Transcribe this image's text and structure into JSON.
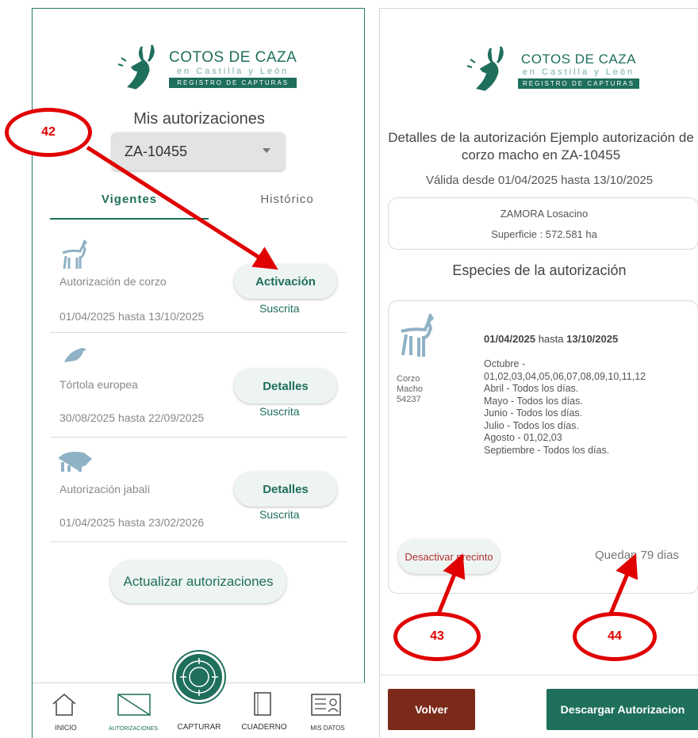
{
  "left": {
    "logo": {
      "title": "COTOS DE CAZA",
      "subtitle": "en Castilla y León",
      "tagline": "REGISTRO DE CAPTURAS"
    },
    "heading": "Mis autorizaciones",
    "coto_select": {
      "value": "ZA-10455"
    },
    "tabs": [
      {
        "label": "Vigentes",
        "active": true
      },
      {
        "label": "Histórico",
        "active": false
      }
    ],
    "items": [
      {
        "name": "Autorización de corzo",
        "dates": "01/04/2025 hasta 13/10/2025",
        "button": "Activación",
        "status": "Suscrita",
        "icon": "deer-icon"
      },
      {
        "name": "Tórtola europea",
        "dates": "30/08/2025 hasta 22/09/2025",
        "button": "Detalles",
        "status": "Suscrita",
        "icon": "bird-icon"
      },
      {
        "name": "Autorización jabalí",
        "dates": "01/04/2025 hasta 23/02/2026",
        "button": "Detalles",
        "status": "Suscrita",
        "icon": "boar-icon"
      }
    ],
    "update_button": "Actualizar autorizaciones",
    "nav": [
      {
        "label": "INICIO",
        "icon": "home-icon"
      },
      {
        "label": "AUTORIZACIONES",
        "icon": "authorization-icon"
      },
      {
        "label": "CAPTURAR",
        "icon": "target-icon"
      },
      {
        "label": "CUADERNO",
        "icon": "notebook-icon"
      },
      {
        "label": "MIS DATOS",
        "icon": "id-card-icon"
      }
    ],
    "callout": "42"
  },
  "right": {
    "logo": {
      "title": "COTOS DE CAZA",
      "subtitle": "en Castilla y León",
      "tagline": "REGISTRO DE CAPTURAS"
    },
    "detail_title": "Detalles de la autorización Ejemplo autorización de corzo macho en ZA-10455",
    "validity": "Válida desde 01/04/2025 hasta 13/10/2025",
    "location": "ZAMORA Losacino",
    "surface": "Superficie : 572.581 ha",
    "species_heading": "Especies de la autorización",
    "species": {
      "name": "Corzo",
      "sex": "Macho",
      "code": "54237",
      "date_from": "01/04/2025",
      "date_to": "13/10/2025",
      "date_sep": "hasta",
      "schedule": [
        "Octubre -",
        "01,02,03,04,05,06,07,08,09,10,11,12",
        "Abril - Todos los días.",
        "Mayo - Todos los días.",
        "Junio - Todos los días.",
        "Julio - Todos los días.",
        "Agosto - 01,02,03",
        "Septiembre - Todos los días."
      ]
    },
    "deactivate_button": "Desactivar precinto",
    "remaining": "Quedan 79 dias",
    "back_button": "Volver",
    "download_button": "Descargar Autorizacion",
    "callouts": [
      "43",
      "44"
    ]
  },
  "colors": {
    "brand": "#1e6f5c",
    "back": "#7b2a1a",
    "callout": "#e00000"
  }
}
